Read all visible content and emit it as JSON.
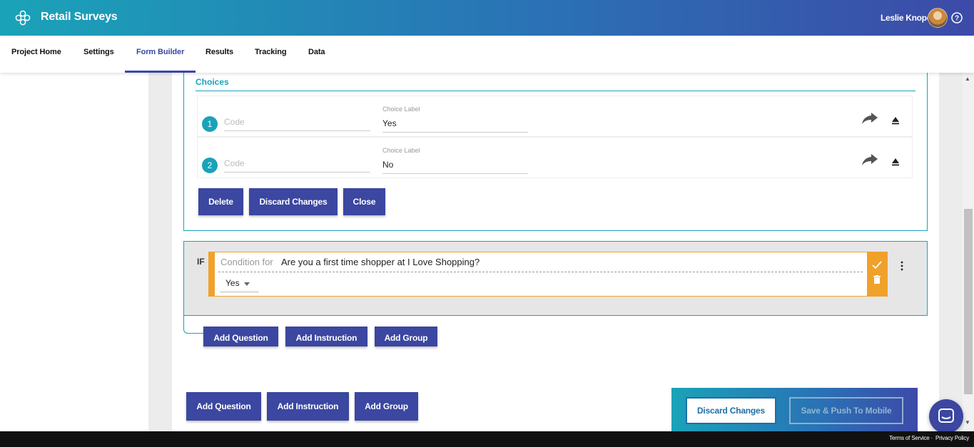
{
  "header": {
    "app_title": "Retail Surveys",
    "user_name": "Leslie Knope"
  },
  "nav": {
    "tabs": [
      {
        "label": "Project Home"
      },
      {
        "label": "Settings"
      },
      {
        "label": "Form Builder",
        "active": true
      },
      {
        "label": "Results"
      },
      {
        "label": "Tracking"
      },
      {
        "label": "Data"
      }
    ]
  },
  "choices": {
    "title": "Choices",
    "code_placeholder": "Code",
    "label_caption": "Choice Label",
    "items": [
      {
        "number": "1",
        "label": "Yes"
      },
      {
        "number": "2",
        "label": "No"
      }
    ],
    "buttons": {
      "delete": "Delete",
      "discard": "Discard Changes",
      "close": "Close"
    }
  },
  "condition": {
    "if_label": "IF",
    "prefix": "Condition for",
    "question": "Are you a first time shopper at I Love Shopping?",
    "selected": "Yes"
  },
  "branch_buttons": {
    "add_question": "Add Question",
    "add_instruction": "Add Instruction",
    "add_group": "Add Group"
  },
  "page_buttons": {
    "add_question": "Add Question",
    "add_instruction": "Add Instruction",
    "add_group": "Add Group"
  },
  "action_bar": {
    "discard": "Discard Changes",
    "save": "Save & Push To Mobile"
  },
  "footer": {
    "terms": "Terms of Service",
    "privacy": "Privacy Policy"
  },
  "colors": {
    "teal": "#1aa3b8",
    "indigo": "#3b47a0",
    "orange": "#f0a12a"
  }
}
